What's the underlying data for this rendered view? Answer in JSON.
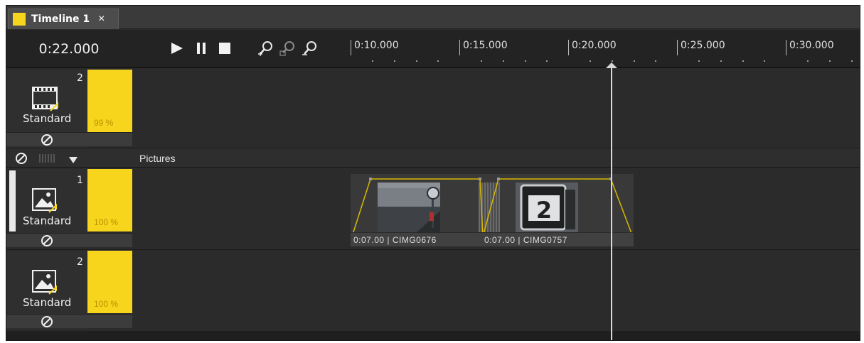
{
  "tab": {
    "title": "Timeline 1",
    "close_glyph": "×",
    "color": "#f7d51d"
  },
  "header": {
    "timecode": "0:22.000",
    "controls": [
      "play-icon",
      "pause-icon",
      "stop-icon",
      "zoom-in-icon",
      "zoom-fit-icon",
      "zoom-out-icon"
    ]
  },
  "ruler": {
    "labels": [
      "0:10.000",
      "0:15.000",
      "0:20.000",
      "0:25.000",
      "0:30.000"
    ]
  },
  "tracks": [
    {
      "type": "video",
      "number": "2",
      "label": "Standard",
      "opacity": "99 %",
      "icon": "film-icon"
    },
    {
      "type": "picture",
      "number": "1",
      "label": "Standard",
      "opacity": "100 %",
      "icon": "picture-icon"
    },
    {
      "type": "picture",
      "number": "2",
      "label": "Standard",
      "opacity": "100 %",
      "icon": "picture-icon"
    }
  ],
  "group": {
    "label": "Pictures"
  },
  "clips": [
    {
      "caption": "0:07.00 | CIMG0676"
    },
    {
      "caption": "0:07.00 | CIMG0757"
    }
  ],
  "playhead_time": "0:22.000",
  "colors": {
    "accent": "#f7d51d",
    "background": "#2b2b2b"
  }
}
